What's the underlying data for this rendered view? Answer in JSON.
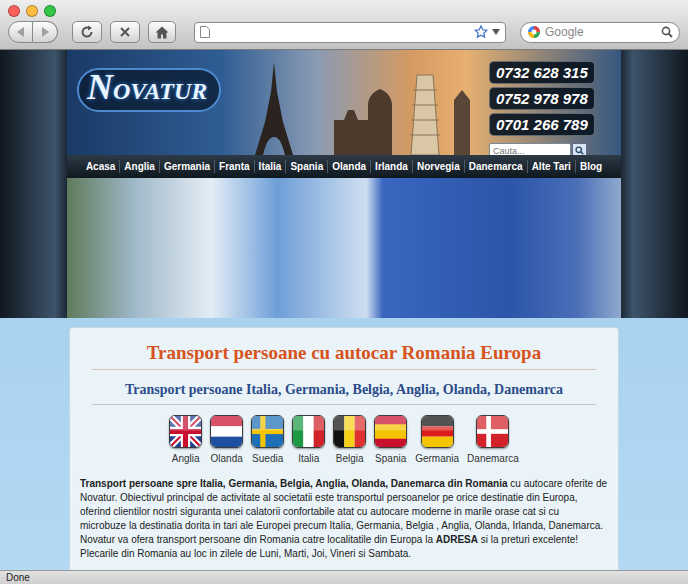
{
  "browser": {
    "search": {
      "placeholder": "Google"
    }
  },
  "header": {
    "logo": "NOVATUR",
    "phones": [
      "0732 628 315",
      "0752 978 978",
      "0701 266 789"
    ],
    "search": {
      "placeholder": "Cauta..."
    }
  },
  "menu": [
    {
      "label": "Acasa"
    },
    {
      "label": "Anglia"
    },
    {
      "label": "Germania"
    },
    {
      "label": "Franta"
    },
    {
      "label": "Italia"
    },
    {
      "label": "Spania"
    },
    {
      "label": "Olanda"
    },
    {
      "label": "Irlanda"
    },
    {
      "label": "Norvegia"
    },
    {
      "label": "Danemarca"
    },
    {
      "label": "Alte Tari"
    },
    {
      "label": "Blog"
    }
  ],
  "content": {
    "title": "Transport persoane cu autocar Romania Europa",
    "subtitle": "Transport persoane Italia, Germania, Belgia, Anglia, Olanda, Danemarca",
    "flags": [
      {
        "label": "Anglia",
        "kind": "uk"
      },
      {
        "label": "Olanda",
        "kind": "nl"
      },
      {
        "label": "Suedia",
        "kind": "se"
      },
      {
        "label": "Italia",
        "kind": "it"
      },
      {
        "label": "Belgia",
        "kind": "be"
      },
      {
        "label": "Spania",
        "kind": "es"
      },
      {
        "label": "Germania",
        "kind": "de"
      },
      {
        "label": "Danemarca",
        "kind": "dk"
      }
    ],
    "paragraphs": [
      {
        "segments": [
          {
            "text": "Transport persoane spre Italia, Germania, Belgia, Anglia, Olanda, Danemarca din Romania",
            "strong": true
          },
          {
            "text": " cu autocare oferite de Novatur. Obiectivul principal de activitate al societatii este transportul persoanelor pe orice destinatie din Europa, oferind clientilor nostri siguranta unei calatorii confortabile atat cu autocare moderne in marile orase cat si cu microbuze la destinatia dorita in tari ale Europei precum Italia, Germania, Belgia , Anglia, Olanda, Irlanda, Danemarca. Novatur va ofera transport persoane din Romania catre localitatile din Europa la ",
            "strong": false
          },
          {
            "text": "ADRESA",
            "strong": true
          },
          {
            "text": " si la preturi excelente!",
            "strong": false
          }
        ]
      },
      {
        "segments": [
          {
            "text": "Plecarile din Romania au loc in zilele de Luni, Marti, Joi, Vineri si Sambata.",
            "strong": false
          }
        ]
      }
    ]
  },
  "status_bar": "Done"
}
